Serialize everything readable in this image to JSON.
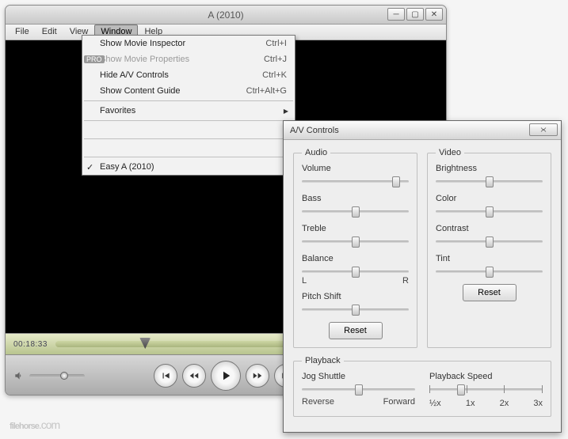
{
  "player": {
    "title": "A (2010)",
    "menu": [
      "File",
      "Edit",
      "View",
      "Window",
      "Help"
    ],
    "active_menu_index": 3,
    "dropdown": {
      "items": [
        {
          "label": "Show Movie Inspector",
          "shortcut": "Ctrl+I"
        },
        {
          "label": "Show Movie Properties",
          "shortcut": "Ctrl+J",
          "pro": true,
          "disabled": true
        },
        {
          "label": "Hide A/V Controls",
          "shortcut": "Ctrl+K"
        },
        {
          "label": "Show Content Guide",
          "shortcut": "Ctrl+Alt+G"
        }
      ],
      "favorites_label": "Favorites",
      "checked_item": "Easy A (2010)"
    },
    "timecode": "00:18:33"
  },
  "av": {
    "title": "A/V Controls",
    "audio": {
      "legend": "Audio",
      "sliders": [
        {
          "label": "Volume",
          "pos": 88
        },
        {
          "label": "Bass",
          "pos": 50
        },
        {
          "label": "Treble",
          "pos": 50
        },
        {
          "label": "Balance",
          "pos": 50,
          "lr": true
        },
        {
          "label": "Pitch Shift",
          "pos": 50
        }
      ],
      "reset": "Reset",
      "L": "L",
      "R": "R"
    },
    "video": {
      "legend": "Video",
      "sliders": [
        {
          "label": "Brightness",
          "pos": 50
        },
        {
          "label": "Color",
          "pos": 50
        },
        {
          "label": "Contrast",
          "pos": 50
        },
        {
          "label": "Tint",
          "pos": 50
        }
      ],
      "reset": "Reset"
    },
    "playback": {
      "legend": "Playback",
      "jog": {
        "label": "Jog Shuttle",
        "pos": 50,
        "reverse": "Reverse",
        "forward": "Forward"
      },
      "speed": {
        "label": "Playback Speed",
        "pos": 25,
        "ticks": [
          "½x",
          "1x",
          "2x",
          "3x"
        ]
      }
    }
  },
  "watermark": {
    "brand": "filehorse",
    "tld": ".com"
  }
}
